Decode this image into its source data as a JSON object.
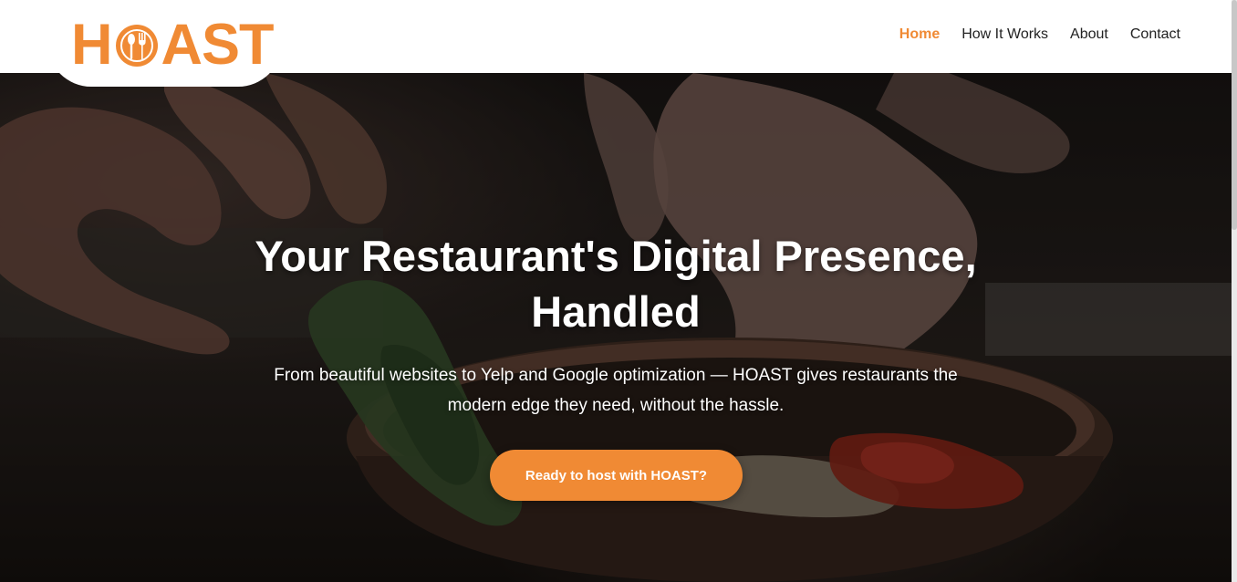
{
  "brand": {
    "logo_left": "H",
    "logo_right": "AST",
    "accent_color": "#f08a34"
  },
  "nav": {
    "items": [
      {
        "label": "Home",
        "active": true
      },
      {
        "label": "How It Works",
        "active": false
      },
      {
        "label": "About",
        "active": false
      },
      {
        "label": "Contact",
        "active": false
      }
    ]
  },
  "hero": {
    "title": "Your Restaurant's Digital Presence, Handled",
    "subtitle": "From beautiful websites to Yelp and Google optimization — HOAST gives restaurants the modern edge they need, without the hassle.",
    "cta_label": "Ready to host with HOAST?"
  },
  "icons": {
    "logo_o_icon": "plate-with-spoon-and-fork-icon"
  }
}
